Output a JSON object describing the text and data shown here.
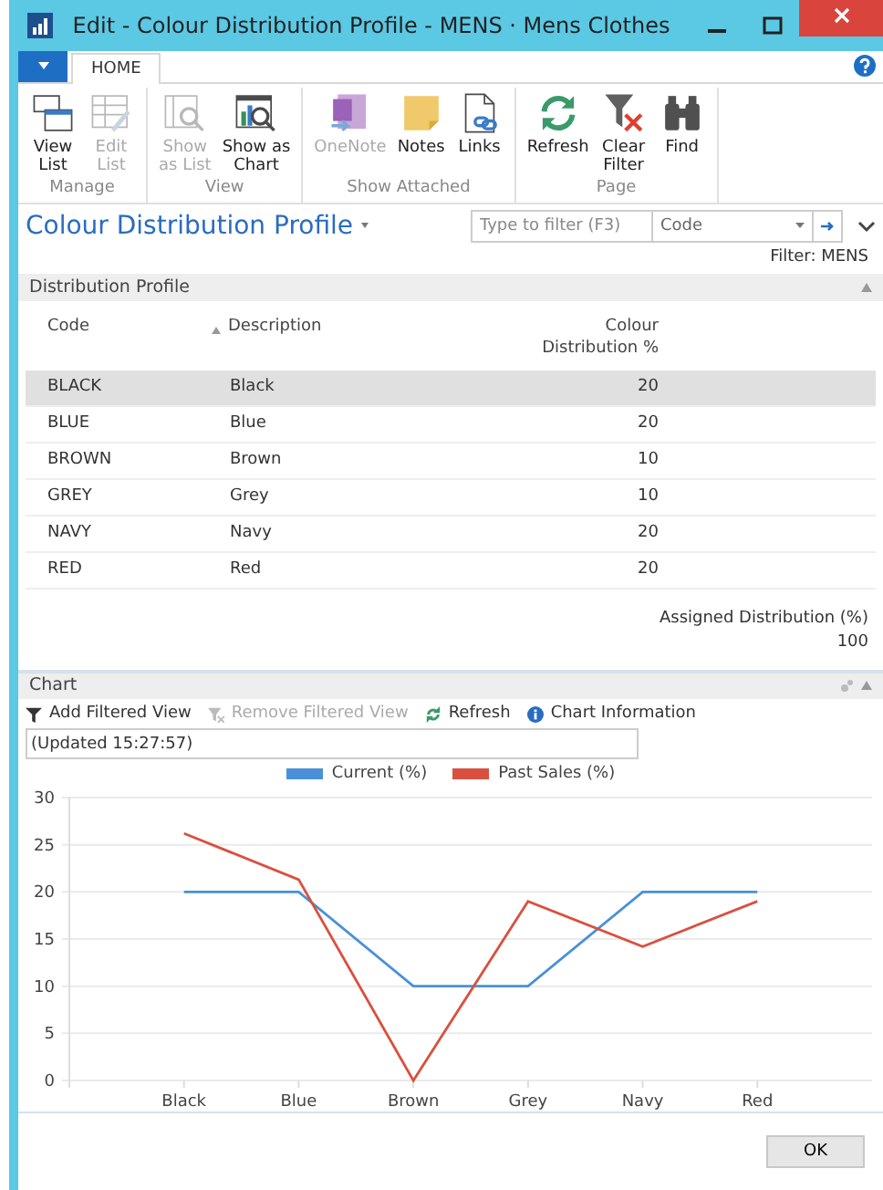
{
  "window": {
    "title": "Edit - Colour Distribution Profile - MENS · Mens Clothes"
  },
  "ribbon_tabs": [
    {
      "label": "HOME",
      "selected": true
    }
  ],
  "ribbon_groups": [
    {
      "label": "Manage",
      "buttons": [
        {
          "kind": "viewlist",
          "lines": [
            "View",
            "List"
          ],
          "disabled": false
        },
        {
          "kind": "editlist",
          "lines": [
            "Edit",
            "List"
          ],
          "disabled": true
        }
      ]
    },
    {
      "label": "View",
      "buttons": [
        {
          "kind": "showlist",
          "lines": [
            "Show",
            "as List"
          ],
          "disabled": true
        },
        {
          "kind": "chart",
          "lines": [
            "Show as",
            "Chart"
          ],
          "disabled": false
        }
      ]
    },
    {
      "label": "Show Attached",
      "buttons": [
        {
          "kind": "onenote",
          "lines": [
            "OneNote"
          ],
          "disabled": true
        },
        {
          "kind": "notes",
          "lines": [
            "Notes"
          ],
          "disabled": false
        },
        {
          "kind": "links",
          "lines": [
            "Links"
          ],
          "disabled": false
        }
      ]
    },
    {
      "label": "Page",
      "buttons": [
        {
          "kind": "refresh",
          "lines": [
            "Refresh"
          ],
          "disabled": false
        },
        {
          "kind": "clearfilter",
          "lines": [
            "Clear",
            "Filter"
          ],
          "disabled": false
        },
        {
          "kind": "find",
          "lines": [
            "Find"
          ],
          "disabled": false
        }
      ]
    }
  ],
  "page_title": "Colour Distribution Profile",
  "filter": {
    "placeholder": "Type to filter (F3)",
    "field": "Code"
  },
  "filter_status": "Filter: MENS",
  "distribution": {
    "title": "Distribution Profile",
    "columns": [
      {
        "lines": [
          "Code"
        ]
      },
      {
        "lines": [
          "Description"
        ]
      },
      {
        "lines": [
          "Colour",
          "Distribution %"
        ]
      }
    ],
    "rows": [
      {
        "code": "BLACK",
        "description": "Black",
        "pct": "20",
        "selected": true
      },
      {
        "code": "BLUE",
        "description": "Blue",
        "pct": "20",
        "selected": false
      },
      {
        "code": "BROWN",
        "description": "Brown",
        "pct": "10",
        "selected": false
      },
      {
        "code": "GREY",
        "description": "Grey",
        "pct": "10",
        "selected": false
      },
      {
        "code": "NAVY",
        "description": "Navy",
        "pct": "20",
        "selected": false
      },
      {
        "code": "RED",
        "description": "Red",
        "pct": "20",
        "selected": false
      }
    ],
    "total_label": "Assigned Distribution (%)",
    "total": "100"
  },
  "chart_part": {
    "title": "Chart",
    "actions": [
      {
        "kind": "filter",
        "label": "Add Filtered View",
        "disabled": false
      },
      {
        "kind": "unfilter",
        "label": "Remove Filtered View",
        "disabled": true
      },
      {
        "kind": "refresh",
        "label": "Refresh",
        "disabled": false
      },
      {
        "kind": "info",
        "label": "Chart Information",
        "disabled": false
      }
    ],
    "updated": "(Updated 15:27:57)",
    "chart_data": {
      "type": "line",
      "grid": true,
      "categories": [
        "Black",
        "Blue",
        "Brown",
        "Grey",
        "Navy",
        "Red"
      ],
      "ylim": [
        0,
        30
      ],
      "yticks": [
        0,
        5,
        10,
        15,
        20,
        25,
        30
      ],
      "series": [
        {
          "name": "Current (%)",
          "color": "#4a90d9",
          "values": [
            20,
            20,
            10,
            10,
            20,
            20
          ]
        },
        {
          "name": "Past Sales (%)",
          "color": "#d9503f",
          "values": [
            26.2,
            21.3,
            0,
            19,
            14.2,
            19
          ]
        }
      ]
    }
  },
  "buttons": [
    "OK"
  ]
}
